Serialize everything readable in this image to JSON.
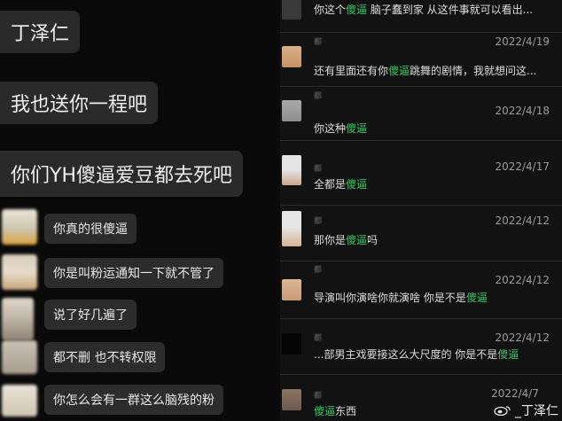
{
  "left_chat": {
    "big_messages": [
      "丁泽仁",
      "我也送你一程吧",
      "你们YH傻逼爱豆都去死吧"
    ],
    "small_messages": [
      "你真的很傻逼",
      "你是叫粉运通知一下就不管了",
      "说了好几遍了",
      "都不删 也不转权限",
      "你怎么会有一群这么脑残的粉"
    ]
  },
  "comments": [
    {
      "date": "",
      "pre": "你这个",
      "hl": "傻逼",
      "post": " 脑子蠢到家 从这件事就可以看出..."
    },
    {
      "date": "2022/4/19",
      "pre": "还有里面还有你",
      "hl": "傻逼",
      "post": "跳舞的剧情，我就想问这..."
    },
    {
      "date": "2022/4/18",
      "pre": "你这种",
      "hl": "傻逼",
      "post": ""
    },
    {
      "date": "2022/4/17",
      "pre": "全都是",
      "hl": "傻逼",
      "post": ""
    },
    {
      "date": "2022/4/12",
      "pre": "那你是",
      "hl": "傻逼",
      "post": "吗"
    },
    {
      "date": "2022/4/12",
      "pre": "导演叫你演啥你就演啥 你是不是",
      "hl": "傻逼",
      "post": ""
    },
    {
      "date": "2022/4/12",
      "pre": "...部男主戏要接这么大尺度的 你是不是",
      "hl": "傻逼",
      "post": ""
    },
    {
      "date": "2022/4/7",
      "pre": "",
      "hl": "傻逼",
      "post": "东西"
    }
  ],
  "colors": {
    "highlight": "#3fc26b",
    "bubble": "#2a2a2a"
  },
  "watermark": {
    "text": "_丁泽仁",
    "logo": "weibo-logo-icon"
  }
}
